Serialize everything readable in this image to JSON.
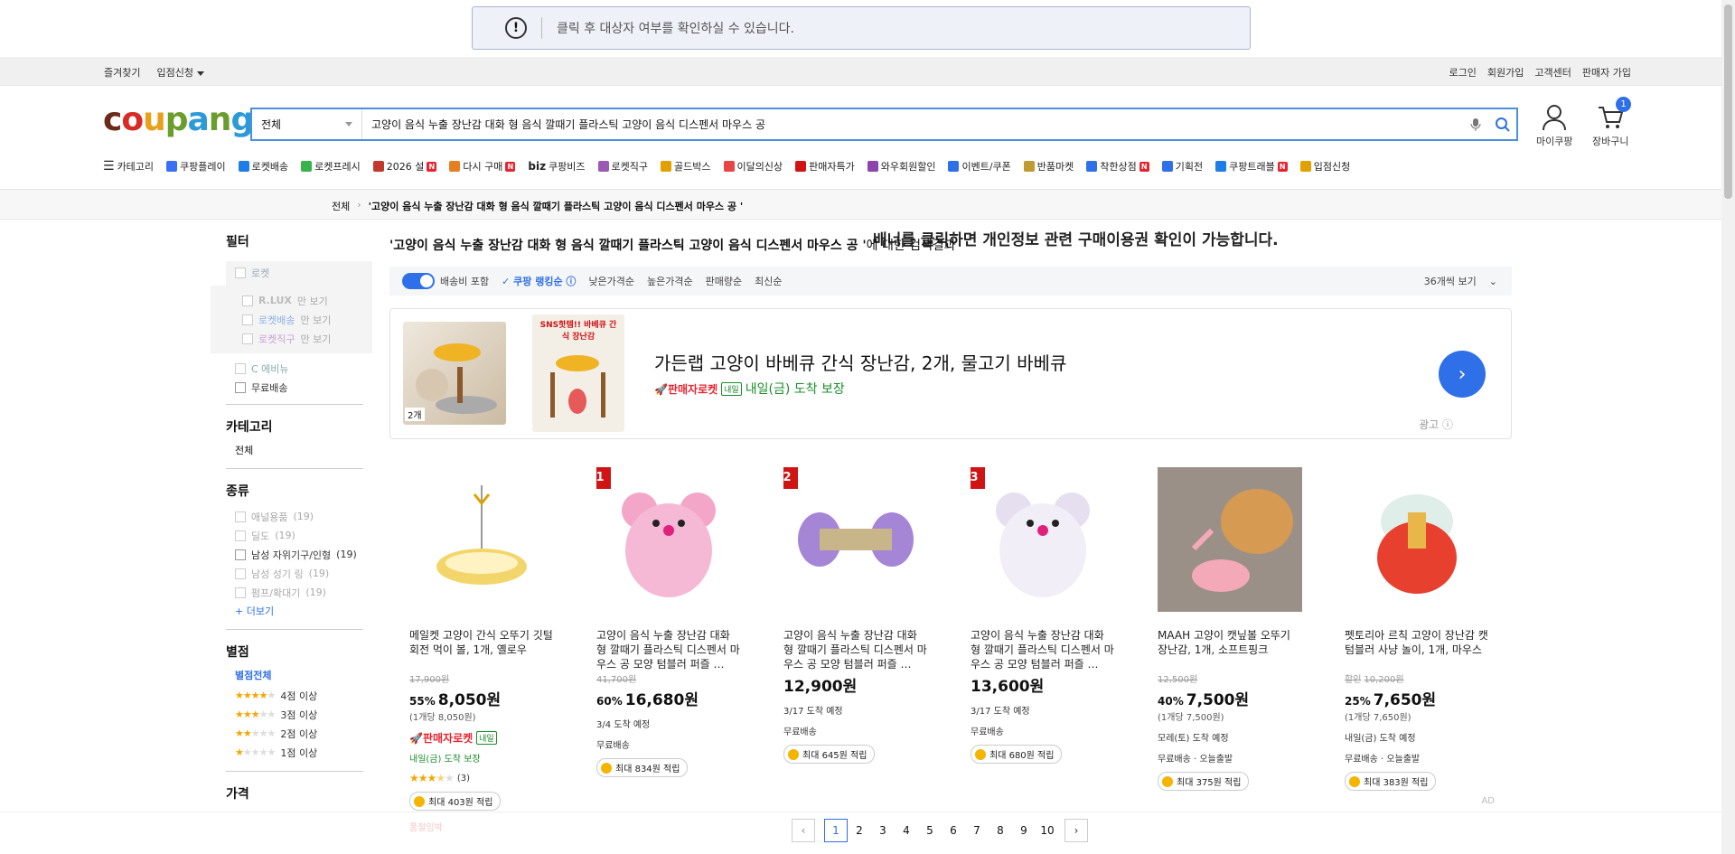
{
  "banner": {
    "icon": "exclamation-icon",
    "main": "배너를 클릭하면 개인정보 관련 구매이용권 확인이 가능합니다.",
    "sub": "클릭 후 대상자 여부를 확인하실 수 있습니다."
  },
  "topbar": {
    "left": [
      "즐겨찾기",
      "입점신청"
    ],
    "right": [
      "로그인",
      "회원가입",
      "고객센터",
      "판매자 가입"
    ]
  },
  "logo": {
    "c": "c",
    "o": "o",
    "u": "u",
    "p": "p",
    "a": "a",
    "n": "n",
    "g": "g"
  },
  "search": {
    "category": "전체",
    "query": "고양이 음식 누출 장난감 대화 형 음식 깔때기 플라스틱 고양이 음식 디스펜서 마우스 공"
  },
  "account": {
    "my": "마이쿠팡",
    "cart": "장바구니",
    "cart_count": "1"
  },
  "nav": [
    {
      "label": "카테고리",
      "icon": "menu-icon"
    },
    {
      "label": "쿠팡플레이",
      "color": "#3b6ff3"
    },
    {
      "label": "로켓배송",
      "color": "#1e7de6"
    },
    {
      "label": "로켓프레시",
      "color": "#37b24d"
    },
    {
      "label": "2026 설",
      "color": "#c0392b",
      "new": "N"
    },
    {
      "label": "다시 구매",
      "color": "#e67e22",
      "new": "N"
    },
    {
      "label": "쿠팡비즈",
      "color": "#222",
      "prefix": "biz"
    },
    {
      "label": "로켓직구",
      "color": "#9b59b6"
    },
    {
      "label": "골드박스",
      "color": "#e1a100"
    },
    {
      "label": "이달의신상",
      "color": "#e84545"
    },
    {
      "label": "판매자특가",
      "color": "#d01414"
    },
    {
      "label": "와우회원할인",
      "color": "#8e44ad"
    },
    {
      "label": "이벤트/쿠폰",
      "color": "#2f6fe8"
    },
    {
      "label": "반품마켓",
      "color": "#c19a32"
    },
    {
      "label": "착한상점",
      "color": "#2f6fe8",
      "new": "N"
    },
    {
      "label": "기획전",
      "color": "#2f6fe8"
    },
    {
      "label": "쿠팡트래블",
      "color": "#1e7de6",
      "new": "N"
    },
    {
      "label": "입점신청",
      "color": "#e1a100"
    }
  ],
  "breadcrumb": {
    "root": "전체",
    "current": "'고양이 음식 누출 장난감 대화 형 음식 깔때기 플라스틱 고양이 음식 디스펜서 마우스 공 '"
  },
  "filter": {
    "title": "필터",
    "rocket": "로켓",
    "sub": [
      {
        "brand": "R.LUX",
        "suffix": "만 보기"
      },
      {
        "brand": "로켓배송",
        "suffix": "만 보기"
      },
      {
        "brand": "로켓직구",
        "suffix": "만 보기"
      }
    ],
    "ebenue": "C 에비뉴",
    "free": "무료배송",
    "category_title": "카테고리",
    "category_all": "전체",
    "kind_title": "종류",
    "kinds": [
      {
        "label": "애널용품",
        "count": "(19)",
        "enabled": false
      },
      {
        "label": "딜도",
        "count": "(19)",
        "enabled": false
      },
      {
        "label": "남성 자위기구/인형",
        "count": "(19)",
        "enabled": true
      },
      {
        "label": "남성 성기 링",
        "count": "(19)",
        "enabled": false
      },
      {
        "label": "펌프/확대기",
        "count": "(19)",
        "enabled": false
      }
    ],
    "more": "+ 더보기",
    "rating_title": "별점",
    "rating_all": "별점전체",
    "ratings": [
      {
        "label": "4점 이상",
        "stars": 4
      },
      {
        "label": "3점 이상",
        "stars": 3
      },
      {
        "label": "2점 이상",
        "stars": 2
      },
      {
        "label": "1점 이상",
        "stars": 1
      }
    ],
    "price_title": "가격"
  },
  "results": {
    "query": "'고양이 음식 누출 장난감 대화 형 음식 깔때기 플라스틱 고양이 음식 디스펜서 마우스 공 '",
    "suffix": "에 대한 검색결과"
  },
  "sort": {
    "shipping": "배송비 포함",
    "options": [
      "쿠팡 랭킹순",
      "낮은가격순",
      "높은가격순",
      "판매량순",
      "최신순"
    ],
    "view": "36개씩 보기"
  },
  "ad": {
    "title": "가든랩 고양이 바베큐 간식 장난감, 2개, 물고기 바베큐",
    "rocket": "판매자로켓",
    "tomorrow": "내일",
    "arrival": "내일(금) 도착 보장",
    "label": "광고",
    "img1_badge": "2개",
    "img2_text": "SNS핫템!! 바베큐 간식 장난감"
  },
  "products": [
    {
      "title": "메일켓 고양이 간식 오뚜기 깃털 회전 먹이 볼, 1개, 옐로우",
      "orig": "17,900원",
      "disc": "55%",
      "price": "8,050원",
      "unit": "(1개당 8,050원)",
      "rocket": "판매자로켓",
      "tomorrow": "내일",
      "arrival": "내일(금) 도착 보장",
      "review": "(3)",
      "points": "최대 403원 적립",
      "extra": "품절임박",
      "stars": 3.5
    },
    {
      "rank": "1",
      "title": "고양이 음식 누출 장난감 대화 형 깔때기 플라스틱 디스펜서 마우스 공 모양 텀블러 퍼즐 …",
      "orig": "41,700원",
      "disc": "60%",
      "price": "16,680원",
      "meta": "3/4 도착 예정",
      "ship": "무료배송",
      "points": "최대 834원 적립"
    },
    {
      "rank": "2",
      "title": "고양이 음식 누출 장난감 대화 형 깔때기 플라스틱 디스펜서 마우스 공 모양 텀블러 퍼즐 …",
      "price": "12,900원",
      "meta": "3/17 도착 예정",
      "ship": "무료배송",
      "points": "최대 645원 적립"
    },
    {
      "rank": "3",
      "title": "고양이 음식 누출 장난감 대화 형 깔때기 플라스틱 디스펜서 마우스 공 모양 텀블러 퍼즐 …",
      "price": "13,600원",
      "meta": "3/17 도착 예정",
      "ship": "무료배송",
      "points": "최대 680원 적립"
    },
    {
      "title": "MAAH 고양이 캣닢볼 오뚜기 장난감, 1개, 소프트핑크",
      "orig": "12,500원",
      "disc": "40%",
      "price": "7,500원",
      "unit": "(1개당 7,500원)",
      "meta": "모레(토) 도착 예정",
      "ship": "무료배송 · 오늘출발",
      "points": "최대 375원 적립"
    },
    {
      "title": "펫토리아 르칙 고양이 장난감 캣 텀블러 사냥 놀이, 1개, 마우스",
      "prefix": "할인",
      "orig": "10,200원",
      "disc": "25%",
      "price": "7,650원",
      "unit": "(1개당 7,650원)",
      "meta": "내일(금) 도착 예정",
      "ship": "무료배송 · 오늘출발",
      "points": "최대 383원 적립",
      "ad": "AD"
    }
  ],
  "pager": {
    "prev": "‹",
    "next": "›",
    "pages": [
      "1",
      "2",
      "3",
      "4",
      "5",
      "6",
      "7",
      "8",
      "9",
      "10"
    ],
    "current": "1"
  },
  "colors": {
    "accent": "#2f6fe8",
    "rank": "#d01414",
    "rocket": "#e8242e",
    "green": "#1a8c2b"
  }
}
